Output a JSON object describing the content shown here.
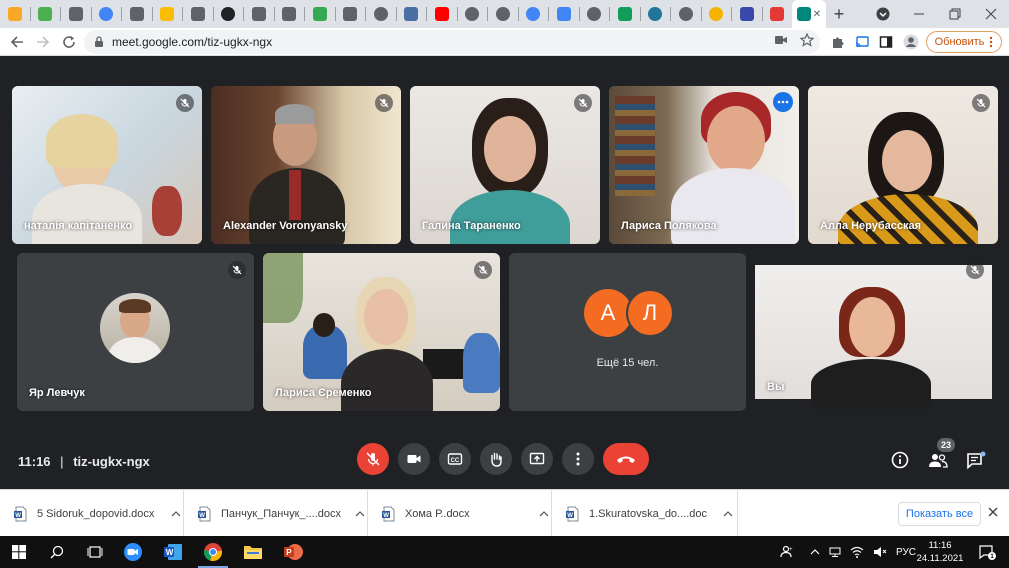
{
  "browser": {
    "tabs": [
      {
        "icon": "lightbulb-icon",
        "color": "#f9a825"
      },
      {
        "icon": "green-square-icon",
        "color": "#4caf50"
      },
      {
        "icon": "wolf-icon",
        "color": "#5f6368"
      },
      {
        "icon": "google-icon",
        "color": "#4285f4"
      },
      {
        "icon": "wolf-icon",
        "color": "#5f6368"
      },
      {
        "icon": "drive-icon",
        "color": "#fbbc04"
      },
      {
        "icon": "wolf-icon",
        "color": "#5f6368"
      },
      {
        "icon": "soccer-ball-icon",
        "color": "#202124"
      },
      {
        "icon": "wolf-icon",
        "color": "#5f6368"
      },
      {
        "icon": "wolf-icon",
        "color": "#5f6368"
      },
      {
        "icon": "sheets-chart-icon",
        "color": "#34a853"
      },
      {
        "icon": "wolf-icon",
        "color": "#5f6368"
      },
      {
        "icon": "globe-icon",
        "color": "#5f6368"
      },
      {
        "icon": "puzzle-icon",
        "color": "#4a6fa5"
      },
      {
        "icon": "youtube-icon",
        "color": "#ff0000"
      },
      {
        "icon": "globe-icon",
        "color": "#5f6368"
      },
      {
        "icon": "globe-icon",
        "color": "#5f6368"
      },
      {
        "icon": "google-icon",
        "color": "#4285f4"
      },
      {
        "icon": "document-icon",
        "color": "#4285f4"
      },
      {
        "icon": "globe-icon",
        "color": "#5f6368"
      },
      {
        "icon": "shield-icon",
        "color": "#0f9d58"
      },
      {
        "icon": "wordpress-icon",
        "color": "#21759b"
      },
      {
        "icon": "globe-icon",
        "color": "#5f6368"
      },
      {
        "icon": "smiley-icon",
        "color": "#f4b400"
      },
      {
        "icon": "diamond-icon",
        "color": "#3949ab"
      },
      {
        "icon": "shop-icon",
        "color": "#e53935"
      },
      {
        "icon": "meet-icon",
        "color": "#00897b",
        "active": true
      }
    ],
    "url": "meet.google.com/tiz-ugkx-ngx",
    "update_label": "Обновить"
  },
  "meet": {
    "participants": [
      {
        "name": "наталія капітаненко",
        "muted": true
      },
      {
        "name": "Alexander Voronyansky",
        "muted": true
      },
      {
        "name": "Галина Тараненко",
        "muted": true
      },
      {
        "name": "Лариса Полякова",
        "muted": false,
        "speaking": true
      },
      {
        "name": "Алла Нерубасская",
        "muted": true
      },
      {
        "name": "Яр Левчук",
        "muted": true
      },
      {
        "name": "Лариса Єременко",
        "muted": true
      },
      {
        "name": "Вы",
        "muted": true
      }
    ],
    "others": {
      "letters": [
        "А",
        "Л"
      ],
      "label": "Ещё 15 чел."
    },
    "time": "11:16",
    "separator": "|",
    "code": "tiz-ugkx-ngx",
    "participant_count": "23",
    "colors": {
      "end_call": "#ea4335",
      "avatar": "#f36c21",
      "speaking": "#8ab4f8"
    }
  },
  "downloads": {
    "items": [
      "5 Sidoruk_dopovid.docx",
      "Панчук_Панчук_....docx",
      "Хома Р..docx",
      "1.Skuratovska_do....doc"
    ],
    "show_all": "Показать все"
  },
  "taskbar": {
    "lang": "РУС",
    "time": "11:16",
    "date": "24.11.2021",
    "notification_count": "1"
  }
}
